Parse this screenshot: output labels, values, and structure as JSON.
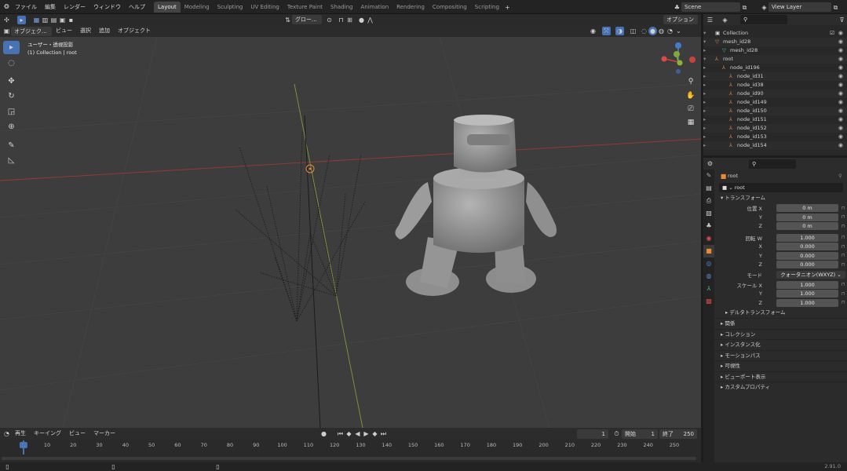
{
  "topbar": {
    "menus": [
      "ファイル",
      "編集",
      "レンダー",
      "ウィンドウ",
      "ヘルプ"
    ],
    "workspaces": [
      "Layout",
      "Modeling",
      "Sculpting",
      "UV Editing",
      "Texture Paint",
      "Shading",
      "Animation",
      "Rendering",
      "Compositing",
      "Scripting"
    ],
    "active_workspace": "Layout",
    "add_tab": "+",
    "scene": "Scene",
    "view_layer": "View Layer"
  },
  "toolheader": {
    "orientation": "グロー...",
    "options": "オプション"
  },
  "viewheader": {
    "mode": "オブジェク...",
    "menus": [
      "ビュー",
      "選択",
      "追加",
      "オブジェクト"
    ]
  },
  "viewport": {
    "projection": "ユーザー・透視投影",
    "collection_info": "(1) Collection | root"
  },
  "outliner": {
    "rows": [
      {
        "name": "Collection",
        "indent": 1,
        "icon": "▣",
        "color": "#d8d8d8",
        "check": true
      },
      {
        "name": "mesh_id28",
        "indent": 1,
        "icon": "▽",
        "color": "#e58b3a"
      },
      {
        "name": "mesh_id28",
        "indent": 2,
        "icon": "▽",
        "color": "#4ec0a0"
      },
      {
        "name": "root",
        "indent": 1,
        "icon": "⅄",
        "color": "#e58b3a"
      },
      {
        "name": "node_id196",
        "indent": 2,
        "icon": "⅄",
        "color": "#e58b3a"
      },
      {
        "name": "node_id31",
        "indent": 3,
        "icon": "⅄",
        "color": "#e58b3a"
      },
      {
        "name": "node_id38",
        "indent": 3,
        "icon": "⅄",
        "color": "#e58b3a"
      },
      {
        "name": "node_id90",
        "indent": 3,
        "icon": "⅄",
        "color": "#e58b3a"
      },
      {
        "name": "node_id149",
        "indent": 3,
        "icon": "⅄",
        "color": "#e58b3a"
      },
      {
        "name": "node_id150",
        "indent": 3,
        "icon": "⅄",
        "color": "#e58b3a"
      },
      {
        "name": "node_id151",
        "indent": 3,
        "icon": "⅄",
        "color": "#e58b3a"
      },
      {
        "name": "node_id152",
        "indent": 3,
        "icon": "⅄",
        "color": "#e58b3a"
      },
      {
        "name": "node_id153",
        "indent": 3,
        "icon": "⅄",
        "color": "#e58b3a"
      },
      {
        "name": "node_id154",
        "indent": 3,
        "icon": "⅄",
        "color": "#e58b3a"
      }
    ]
  },
  "properties": {
    "object_name": "root",
    "object_field": "root",
    "transform_header": "トランスフォーム",
    "location": {
      "label_x": "位置 X",
      "label_y": "Y",
      "label_z": "Z",
      "x": "0 m",
      "y": "0 m",
      "z": "0 m"
    },
    "rotation": {
      "label_w": "回転 W",
      "label_x": "X",
      "label_y": "Y",
      "label_z": "Z",
      "w": "1.000",
      "x": "0.000",
      "y": "0.000",
      "z": "0.000"
    },
    "mode_label": "モード",
    "mode_value": "クォータニオン(WXYZ)",
    "scale": {
      "label_x": "スケール X",
      "label_y": "Y",
      "label_z": "Z",
      "x": "1.000",
      "y": "1.000",
      "z": "1.000"
    },
    "delta": "デルタトランスフォーム",
    "panels": [
      "関係",
      "コレクション",
      "インスタンス化",
      "モーションパス",
      "可視性",
      "ビューポート表示",
      "カスタムプロパティ"
    ]
  },
  "timeline": {
    "menus": [
      "再生",
      "キーイング",
      "ビュー",
      "マーカー"
    ],
    "current_frame": "1",
    "start_label": "開始",
    "start": "1",
    "end_label": "終了",
    "end": "250",
    "ticks": [
      "1",
      "10",
      "20",
      "30",
      "40",
      "50",
      "60",
      "70",
      "80",
      "90",
      "100",
      "110",
      "120",
      "130",
      "140",
      "150",
      "160",
      "170",
      "180",
      "190",
      "200",
      "210",
      "220",
      "230",
      "240",
      "250"
    ]
  },
  "status": {
    "version": "2.91.0"
  },
  "colors": {
    "accent": "#4772b3",
    "x_axis": "#c8423c",
    "y_axis": "#8ab33a",
    "object": "#e58b3a"
  }
}
